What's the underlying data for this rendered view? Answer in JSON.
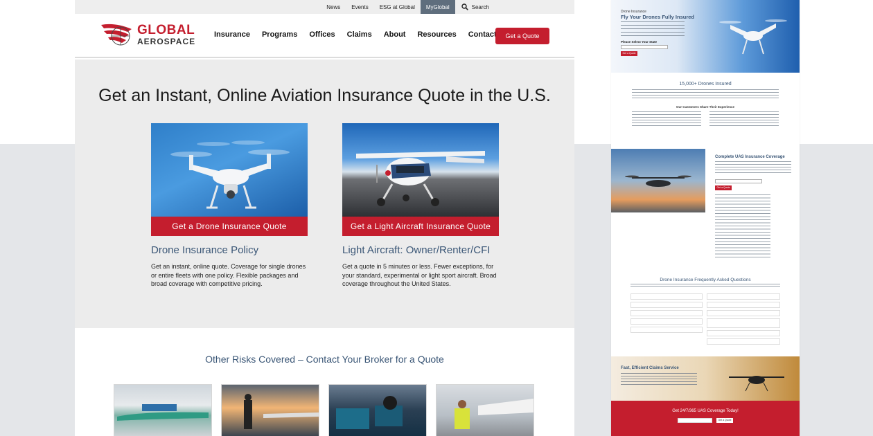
{
  "utility": {
    "links": [
      "News",
      "Events",
      "ESG at Global",
      "MyGlobal"
    ],
    "search_label": "Search"
  },
  "logo": {
    "line1": "GLOBAL",
    "line2": "AEROSPACE"
  },
  "nav": {
    "items": [
      "Insurance",
      "Programs",
      "Offices",
      "Claims",
      "About",
      "Resources",
      "Contact"
    ],
    "cta": "Get a Quote"
  },
  "hero": {
    "title": "Get an Instant, Online Aviation Insurance Quote in the U.S.",
    "cards": [
      {
        "button": "Get a Drone Insurance Quote",
        "heading": "Drone Insurance Policy",
        "body": "Get an instant, online quote. Coverage for single drones or entire fleets with one policy. Flexible packages and broad coverage with competitive pricing."
      },
      {
        "button": "Get a Light Aircraft Insurance Quote",
        "heading": "Light Aircraft: Owner/Renter/CFI",
        "body": "Get a quote in 5 minutes or less. Fewer exceptions, for your standard, experimental or light sport aircraft. Broad coverage throughout the United States."
      }
    ]
  },
  "other": {
    "title": "Other Risks Covered – Contact Your Broker for a Quote"
  },
  "preview": {
    "s1_small": "Drone Insurance",
    "s1_title": "Fly Your Drones Fully Insured",
    "s1_select_label": "Please Select Your State",
    "s1_button": "Get a Quote",
    "s2_title": "15,000+ Drones Insured",
    "s2_sub": "Our Customers Share Their Experience",
    "s3_title": "Complete UAS Insurance Coverage",
    "s3_button": "Get a Quote",
    "s4_title": "Drone Insurance Frequently Asked Questions",
    "s5_title": "Fast, Efficient Claims Service",
    "s6_title": "Get 24/7/365 UAS Coverage Today!",
    "s6_button": "Get a Quote"
  },
  "colors": {
    "brand_red": "#c41e2e",
    "heading_blue": "#3a5676",
    "mygl_bg": "#5f6e7d"
  }
}
